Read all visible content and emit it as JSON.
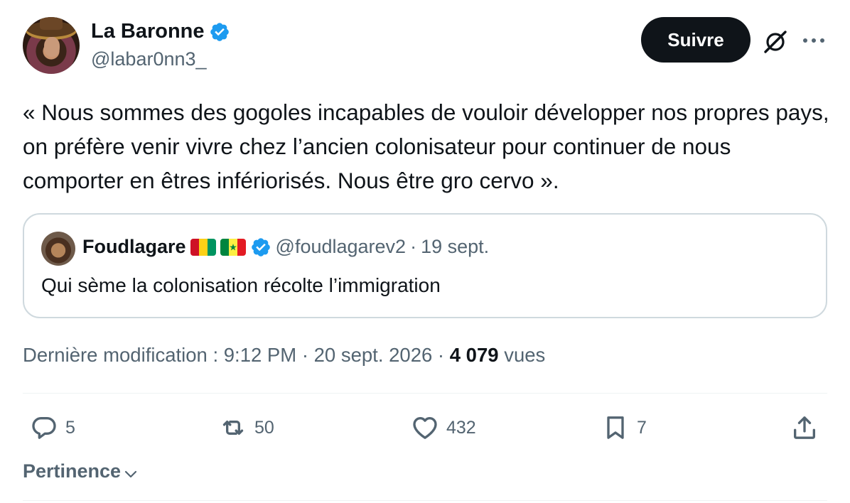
{
  "author": {
    "name": "La Baronne",
    "handle": "@labar0nn3_",
    "verified": true
  },
  "follow_label": "Suivre",
  "icons": {
    "verified": "verified-badge-icon",
    "grok": "grok-icon",
    "more": "more-icon",
    "reply": "reply-icon",
    "retweet": "retweet-icon",
    "like": "heart-icon",
    "bookmark": "bookmark-icon",
    "share": "share-icon",
    "chevron": "chevron-down-icon"
  },
  "tweet": {
    "text": "« Nous sommes des gogoles incapables de vouloir développer nos propres pays, on préfère venir vivre chez l’ancien colonisateur pour continuer de nous comporter en êtres infériorisés. Nous être gro cervo »."
  },
  "quote": {
    "name": "Foudlagare",
    "handle": "@foudlagarev2",
    "separator": "·",
    "date": "19 sept.",
    "text": "Qui sème la colonisation récolte l’immigration"
  },
  "meta": {
    "edited_label": "Dernière modification : 9:12 PM · 20 sept. 2026 ·",
    "views_count": "4 079",
    "views_label": "vues"
  },
  "actions": {
    "replies": "5",
    "retweets": "50",
    "likes": "432",
    "bookmarks": "7"
  },
  "sort_label": "Pertinence",
  "colors": {
    "accent": "#1d9bf0",
    "text": "#0f1419",
    "muted": "#536471",
    "border": "#cfd9de"
  }
}
